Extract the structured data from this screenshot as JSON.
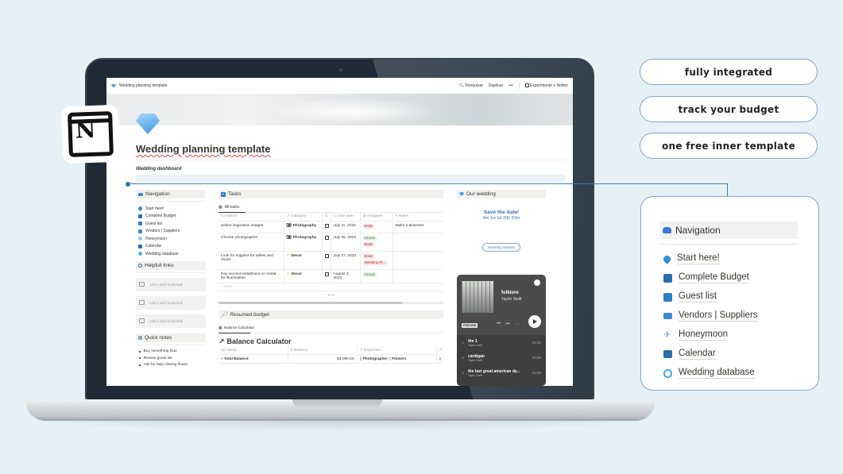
{
  "topbar": {
    "breadcrumb": "Wedding planning template",
    "search": "Pesquisar",
    "duplicate": "Duplicar",
    "more": "•••",
    "try_notion": "Experimente o Notion"
  },
  "page": {
    "title": "Wedding planning template",
    "dashboard_label": "Wedding dashboard"
  },
  "navigation": {
    "title": "Navigation",
    "items": [
      {
        "label": "Start here!",
        "icon": "map-pin-icon"
      },
      {
        "label": "Complete Budget",
        "icon": "budget-icon"
      },
      {
        "label": "Guest list",
        "icon": "people-icon"
      },
      {
        "label": "Vendors | Suppliers",
        "icon": "atm-icon"
      },
      {
        "label": "Honeymoon",
        "icon": "airplane-icon"
      },
      {
        "label": "Calendar",
        "icon": "calendar-icon"
      },
      {
        "label": "Wedding database",
        "icon": "database-icon"
      }
    ]
  },
  "helpful_links": {
    "title": "Helpfull links",
    "bookmarks": [
      "Add a web bookmark",
      "Add a web bookmark",
      "Add a web bookmark"
    ]
  },
  "quick_notes": {
    "title": "Quick notes",
    "items": [
      "Buy something blue",
      "Review guest list",
      "Ask for help closing flower"
    ]
  },
  "tasks": {
    "title": "Tasks",
    "view": "All tasks",
    "columns": [
      "Aa Name",
      "Category",
      "",
      "Due date",
      "Assignee",
      "Notes"
    ],
    "rows": [
      {
        "name": "Select inspiration images",
        "category": "Photography",
        "due": "July 11, 2023",
        "assignees": [
          "Bride"
        ],
        "notes": "Make a pinterest"
      },
      {
        "name": "Choose photographer",
        "category": "Photography",
        "due": "July 26, 2023",
        "assignees": [
          "Groom",
          "Bride"
        ],
        "notes": ""
      },
      {
        "name": "Look for supplier for tables and chairs",
        "category": "Decor",
        "due": "July 27, 2023",
        "assignees": [
          "Bride",
          "Wedding Pl..."
        ],
        "notes": ""
      },
      {
        "name": "Pay second installment on rental for illumination",
        "category": "Decor",
        "due": "August 3, 2023",
        "assignees": [
          "Groom"
        ],
        "notes": ""
      }
    ],
    "new_label": "+ New",
    "calc_label": "☑ 0"
  },
  "budget": {
    "title": "Resumed budget",
    "view": "Balance Calculator",
    "table_title": "Balance Calculator",
    "columns": [
      "Aa Name",
      "Σ Balance",
      "Expenses",
      ""
    ],
    "rows": [
      {
        "name": "Total Balance",
        "balance": "$4,090.00",
        "expenses": [
          "Photographer",
          "Flowers"
        ]
      }
    ]
  },
  "wedding": {
    "title": "Our wedding",
    "save_date": "Save the date!",
    "countdown": "4m 1w 1d 20h 53m",
    "website_button": "Wedding website"
  },
  "spotify": {
    "album": "folklore",
    "artist": "Taylor Swift",
    "preview": "PREVIEW",
    "tracks": [
      {
        "num": "1",
        "title": "the 1",
        "artist": "Taylor Swift",
        "duration": "03:30"
      },
      {
        "num": "2",
        "title": "cardigan",
        "artist": "Taylor Swift",
        "duration": "03:59"
      },
      {
        "num": "3",
        "title": "the last great american dy...",
        "artist": "Taylor Swift",
        "duration": "03:50"
      }
    ]
  },
  "features": [
    "fully integrated",
    "track your budget",
    "one free inner template"
  ],
  "colors": {
    "accent": "#2e74b5",
    "background": "#e6f1f7",
    "border": "#7aa7cf"
  }
}
